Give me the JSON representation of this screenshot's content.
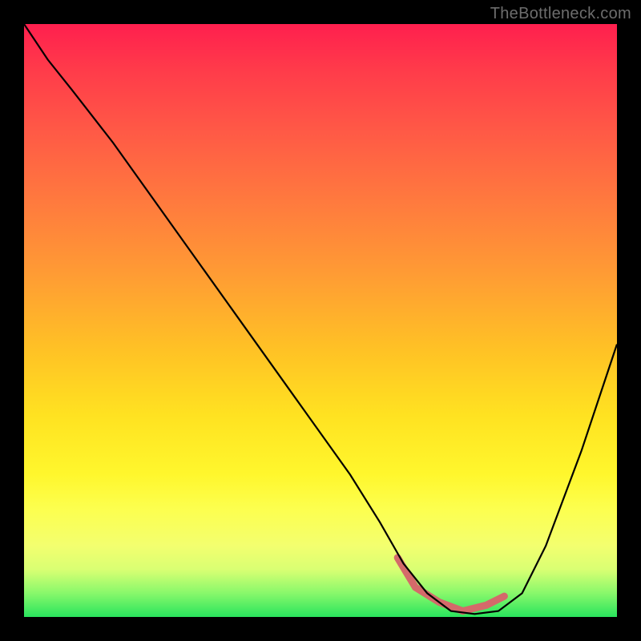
{
  "watermark": "TheBottleneck.com",
  "chart_data": {
    "type": "line",
    "title": "",
    "xlabel": "",
    "ylabel": "",
    "xlim": [
      0,
      100
    ],
    "ylim": [
      0,
      100
    ],
    "grid": false,
    "background": "heat-gradient",
    "gradient_stops": [
      {
        "pos": 0,
        "color": "#ff1f4e"
      },
      {
        "pos": 18,
        "color": "#ff5946"
      },
      {
        "pos": 42,
        "color": "#ff9b34"
      },
      {
        "pos": 66,
        "color": "#ffe221"
      },
      {
        "pos": 88,
        "color": "#f3ff6f"
      },
      {
        "pos": 100,
        "color": "#29e45d"
      }
    ],
    "series": [
      {
        "name": "bottleneck-curve",
        "x": [
          0,
          4,
          8,
          15,
          25,
          35,
          45,
          55,
          60,
          64,
          68,
          72,
          76,
          80,
          84,
          88,
          94,
          100
        ],
        "y": [
          100,
          94,
          89,
          80,
          66,
          52,
          38,
          24,
          16,
          9,
          4,
          1,
          0.5,
          1,
          4,
          12,
          28,
          46
        ]
      }
    ],
    "highlight": {
      "name": "trough-highlight",
      "color": "#d46a6a",
      "x": [
        63,
        66,
        70,
        74,
        78,
        81
      ],
      "y": [
        10,
        5,
        2.5,
        1,
        2,
        3.5
      ]
    }
  }
}
